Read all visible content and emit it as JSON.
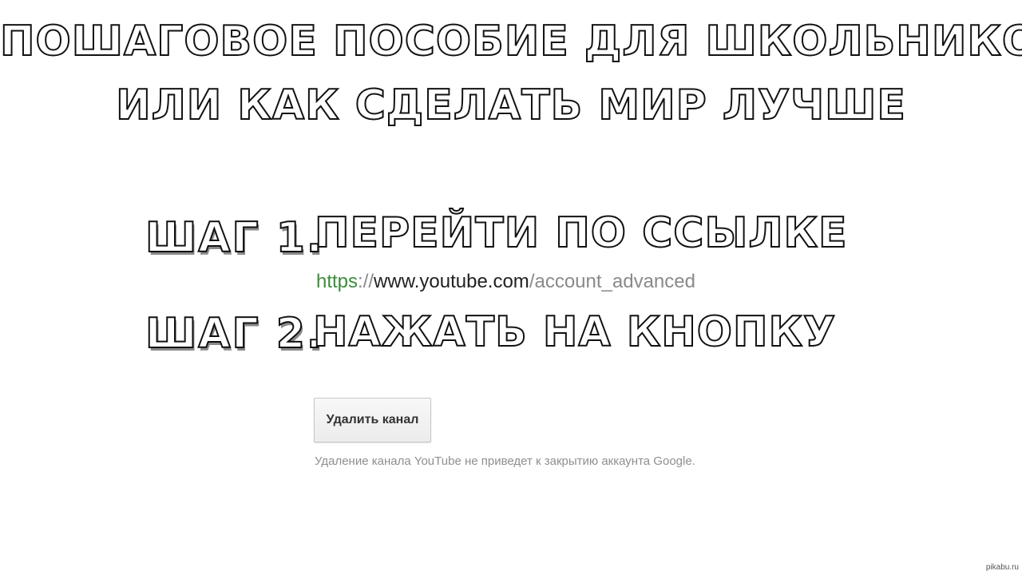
{
  "title": {
    "line1": "ПОШАГОВОЕ ПОСОБИЕ ДЛЯ ШКОЛЬНИКОВ",
    "line2": "ИЛИ КАК СДЕЛАТЬ МИР ЛУЧШЕ"
  },
  "steps": [
    {
      "label": "ШАГ 1.",
      "instruction": "ПЕРЕЙТИ ПО ССЫЛКЕ"
    },
    {
      "label": "ШАГ 2.",
      "instruction": "НАЖАТЬ НА КНОПКУ"
    }
  ],
  "link": {
    "scheme": "https",
    "separator": "://",
    "host": "www.youtube.com",
    "path": "/account_advanced"
  },
  "youtube_settings": {
    "delete_button_label": "Удалить канал",
    "delete_note": "Удаление канала YouTube не приведет к закрытию аккаунта Google."
  },
  "watermark": "pikabu.ru",
  "colors": {
    "url_scheme": "#3b8d3b",
    "url_muted": "#8a8a8a",
    "outline": "#111111"
  }
}
